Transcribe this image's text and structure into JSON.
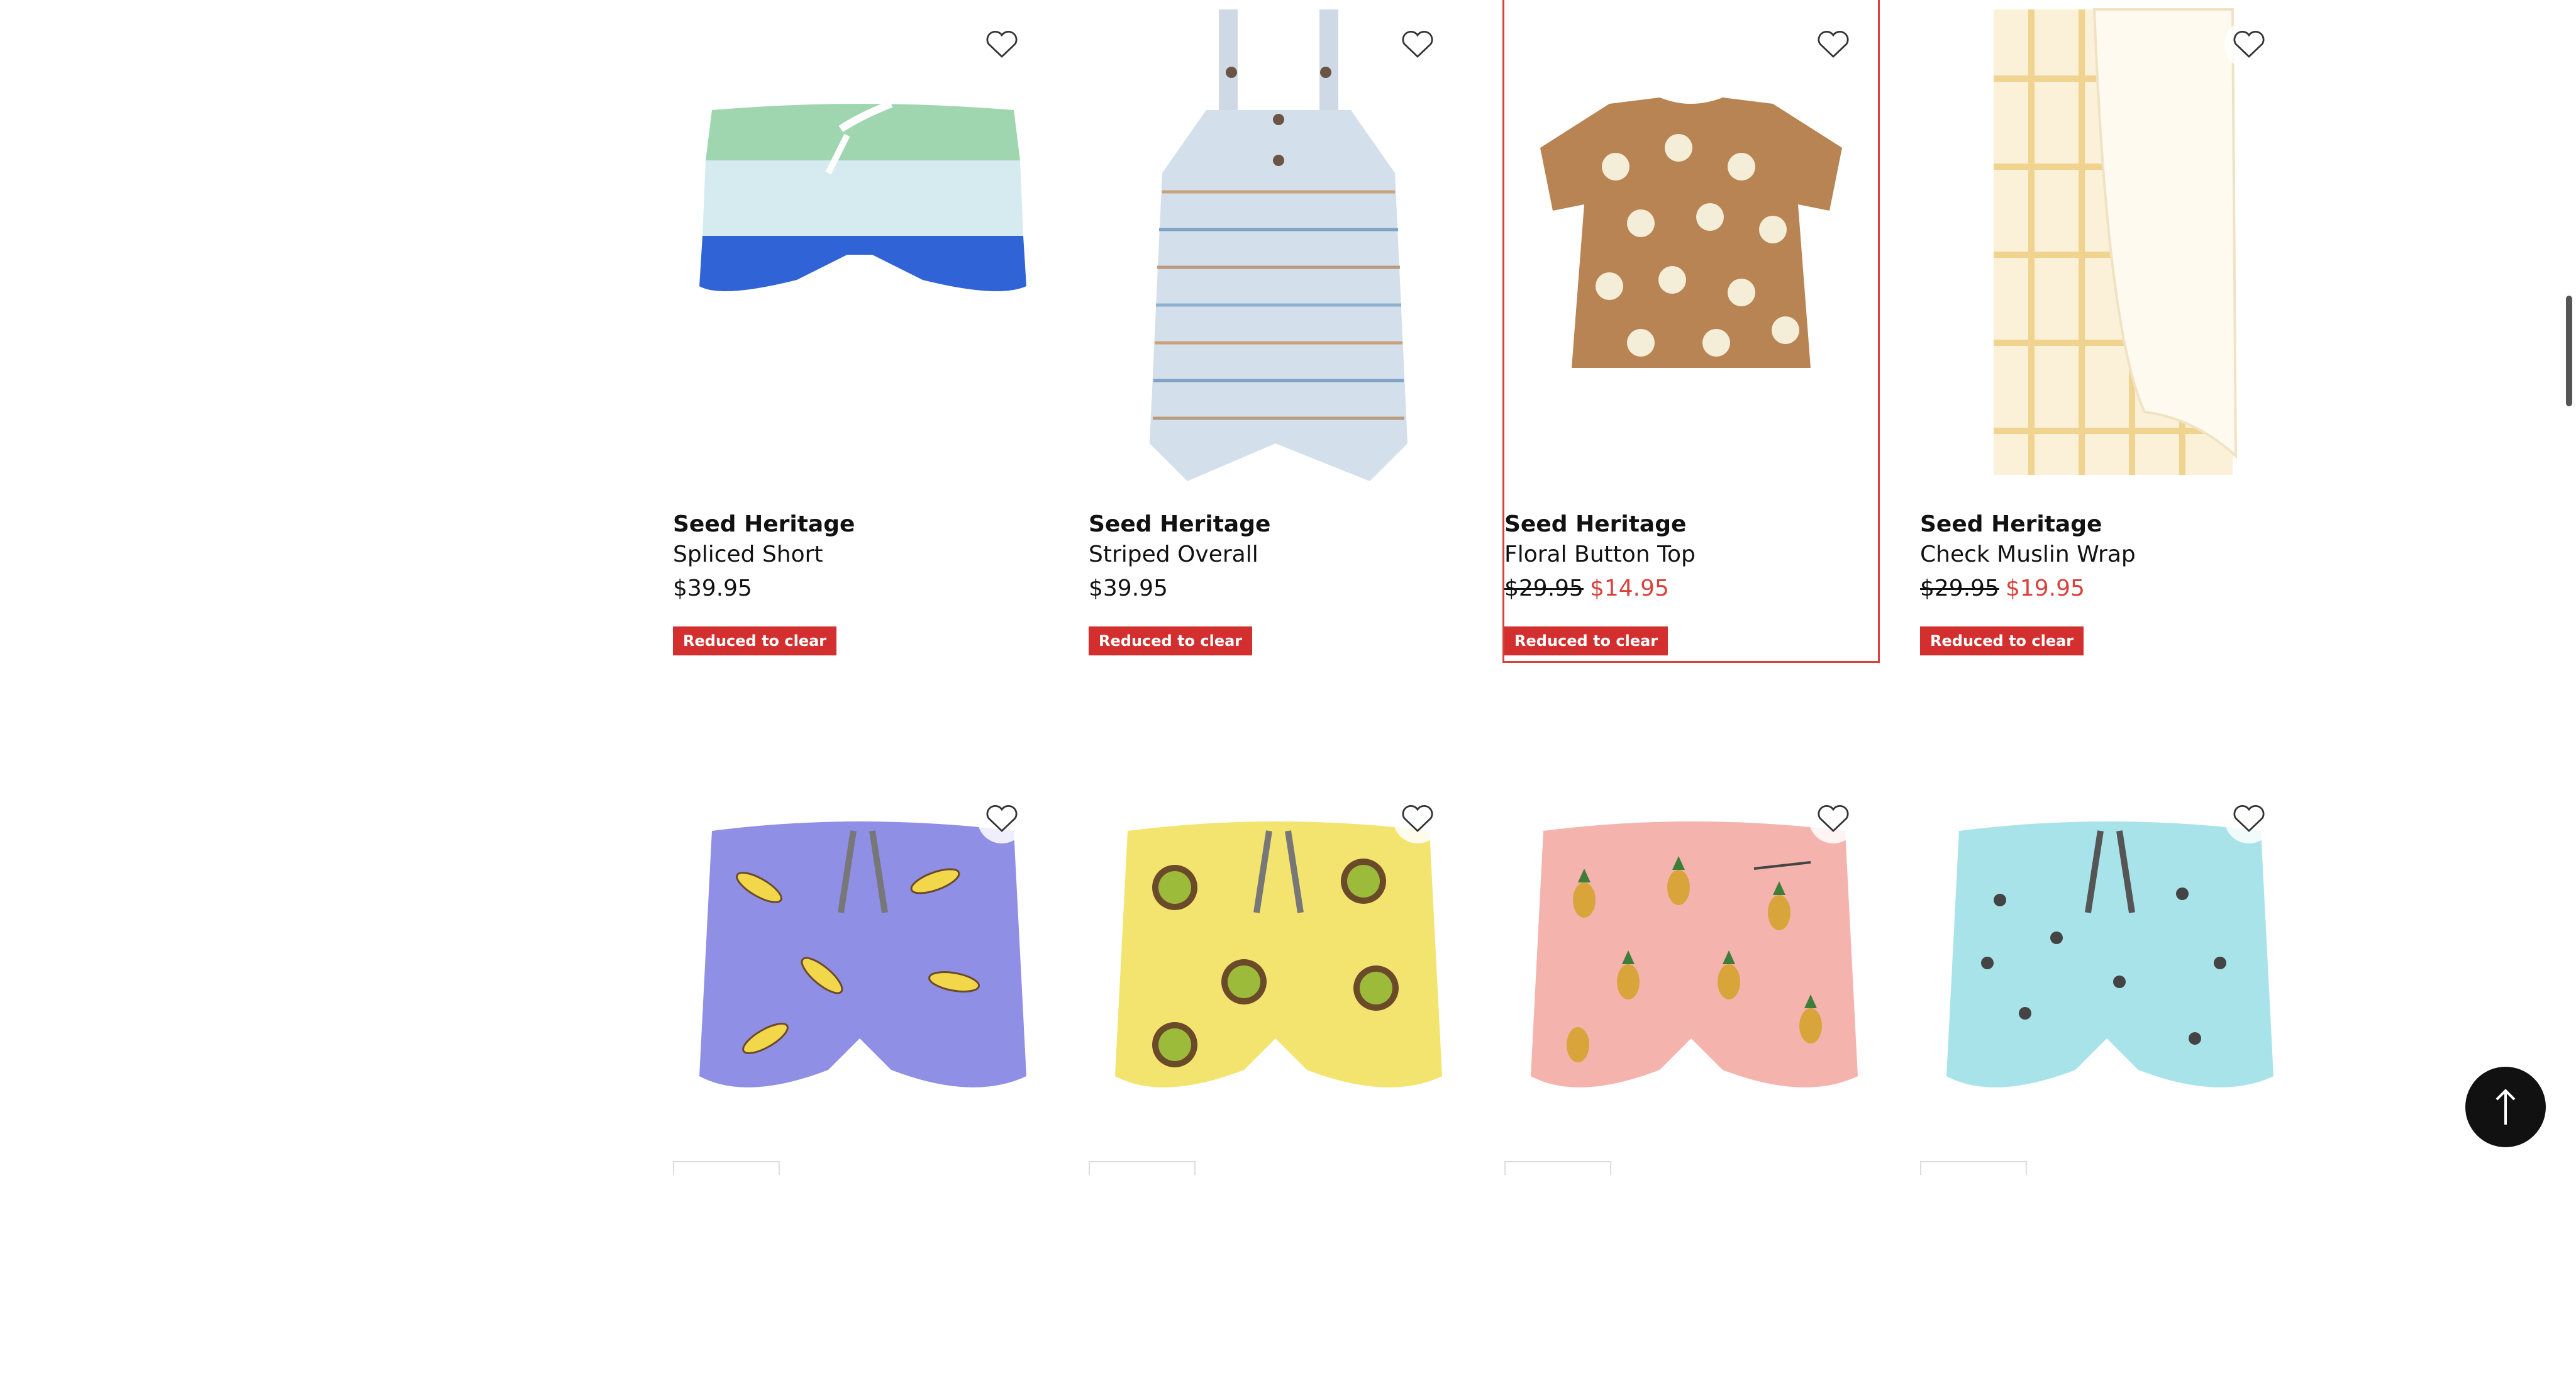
{
  "colors": {
    "accent_red": "#d9413c",
    "badge_red": "#d32f2f",
    "text": "#111111"
  },
  "products": [
    {
      "brand": "Seed Heritage",
      "name": "Spliced Short",
      "price": "$39.95",
      "sale_price": "",
      "badge": "Reduced to clear",
      "image_icon": "spliced-short-image"
    },
    {
      "brand": "Seed Heritage",
      "name": "Striped Overall",
      "price": "$39.95",
      "sale_price": "",
      "badge": "Reduced to clear",
      "image_icon": "striped-overall-image"
    },
    {
      "brand": "Seed Heritage",
      "name": "Floral Button Top",
      "price": "$29.95",
      "sale_price": "$14.95",
      "badge": "Reduced to clear",
      "image_icon": "floral-top-image"
    },
    {
      "brand": "Seed Heritage",
      "name": "Check Muslin Wrap",
      "price": "$29.95",
      "sale_price": "$19.95",
      "badge": "Reduced to clear",
      "image_icon": "muslin-wrap-image"
    }
  ],
  "row2_products": [
    {
      "image_icon": "banana-swim-short-image"
    },
    {
      "image_icon": "kiwi-swim-short-image"
    },
    {
      "image_icon": "pineapple-swim-short-image"
    },
    {
      "image_icon": "aqua-print-swim-short-image"
    }
  ],
  "wishlist_icon": "heart-icon",
  "back_to_top_icon": "arrow-up-icon"
}
